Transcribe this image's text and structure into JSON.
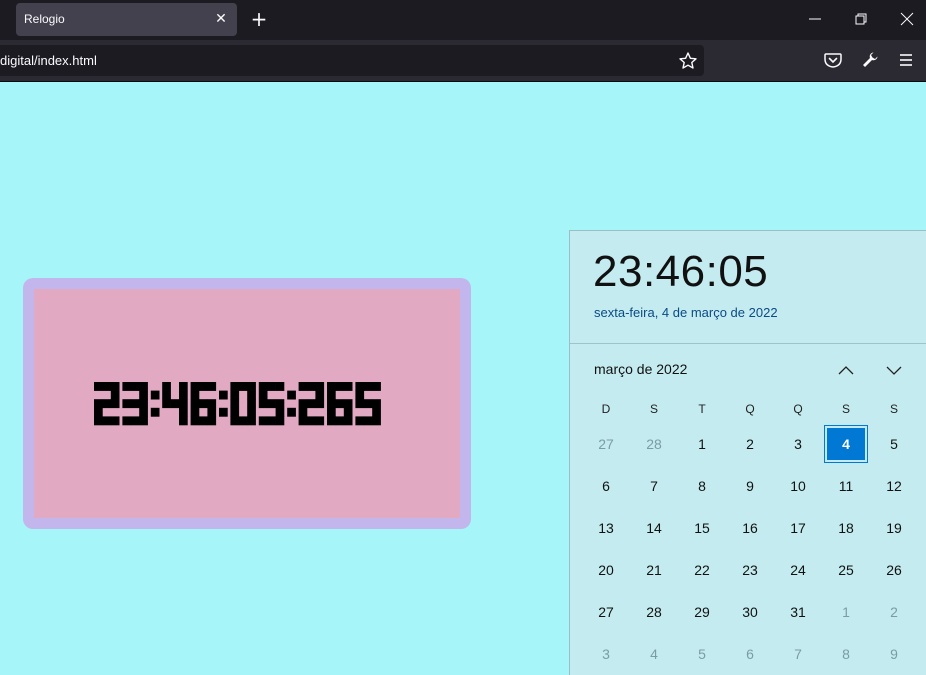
{
  "browser": {
    "tab_title": "Relogio",
    "tab_close": "✕",
    "new_tab": "+",
    "url": "digital/index.html"
  },
  "clock": {
    "display": "23:46:05:265",
    "colors": {
      "frame": "#c3b6ec",
      "face": "#e1a9c2",
      "digits": "#000000",
      "page_bg": "#a6f5f8"
    }
  },
  "flyout": {
    "time": "23:46:05",
    "date": "sexta-feira, 4 de março de 2022",
    "month_label": "março de 2022",
    "weekdays": [
      "D",
      "S",
      "T",
      "Q",
      "Q",
      "S",
      "S"
    ],
    "weeks": [
      [
        {
          "d": "27",
          "dim": true
        },
        {
          "d": "28",
          "dim": true
        },
        {
          "d": "1"
        },
        {
          "d": "2"
        },
        {
          "d": "3"
        },
        {
          "d": "4",
          "today": true
        },
        {
          "d": "5"
        }
      ],
      [
        {
          "d": "6"
        },
        {
          "d": "7"
        },
        {
          "d": "8"
        },
        {
          "d": "9"
        },
        {
          "d": "10"
        },
        {
          "d": "11"
        },
        {
          "d": "12"
        }
      ],
      [
        {
          "d": "13"
        },
        {
          "d": "14"
        },
        {
          "d": "15"
        },
        {
          "d": "16"
        },
        {
          "d": "17"
        },
        {
          "d": "18"
        },
        {
          "d": "19"
        }
      ],
      [
        {
          "d": "20"
        },
        {
          "d": "21"
        },
        {
          "d": "22"
        },
        {
          "d": "23"
        },
        {
          "d": "24"
        },
        {
          "d": "25"
        },
        {
          "d": "26"
        }
      ],
      [
        {
          "d": "27"
        },
        {
          "d": "28"
        },
        {
          "d": "29"
        },
        {
          "d": "30"
        },
        {
          "d": "31"
        },
        {
          "d": "1",
          "dim": true
        },
        {
          "d": "2",
          "dim": true
        }
      ],
      [
        {
          "d": "3",
          "dim": true
        },
        {
          "d": "4",
          "dim": true
        },
        {
          "d": "5",
          "dim": true
        },
        {
          "d": "6",
          "dim": true
        },
        {
          "d": "7",
          "dim": true
        },
        {
          "d": "8",
          "dim": true
        },
        {
          "d": "9",
          "dim": true
        }
      ]
    ],
    "accent": "#0078d4"
  },
  "icons": {
    "minimize": "minimize-icon",
    "maximize": "restore-icon",
    "close": "close-icon",
    "bookmark": "star-icon",
    "pocket": "pocket-icon",
    "tools": "wrench-icon",
    "menu": "hamburger-menu-icon",
    "prev": "chevron-up-icon",
    "next": "chevron-down-icon"
  }
}
